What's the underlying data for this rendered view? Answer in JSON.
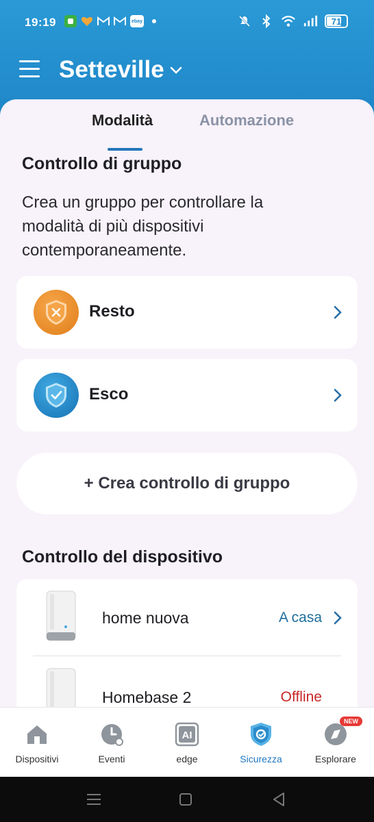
{
  "status_bar": {
    "time": "19:19",
    "battery": "71",
    "notification_icons": [
      "app-icon-green",
      "heart-icon",
      "gmail-icon",
      "gmail-icon",
      "ebay-icon",
      "dot-icon"
    ],
    "notification_colors": [
      "#3cb043",
      "#f3a73b"
    ],
    "ebay_label": "ebay",
    "system_icons": [
      "mute-icon",
      "bluetooth-icon",
      "wifi-icon",
      "signal-icon",
      "battery-icon"
    ]
  },
  "header": {
    "title": "Setteville",
    "menu_icon": "hamburger-icon",
    "dropdown_icon": "chevron-down-icon",
    "background": "#2a9ad6"
  },
  "tabs": [
    {
      "label": "Modalità",
      "active": true
    },
    {
      "label": "Automazione",
      "active": false
    }
  ],
  "group_control": {
    "title": "Controllo di gruppo",
    "description": "Crea un gruppo per controllare la modalità di più dispositivi contemporaneamente.",
    "items": [
      {
        "name": "Resto",
        "icon": "shield-x-icon",
        "color": "#ee8a24"
      },
      {
        "name": "Esco",
        "icon": "shield-check-icon",
        "color": "#1e8fd0"
      }
    ],
    "create_button": "+ Crea controllo di gruppo"
  },
  "device_control": {
    "title": "Controllo del dispositivo",
    "devices": [
      {
        "name": "home nuova",
        "status": "A casa",
        "status_color": "#1f6e9e"
      },
      {
        "name": "Homebase 2",
        "status": "Offline",
        "status_color": "#c62828"
      }
    ]
  },
  "bottom_nav": [
    {
      "label": "Dispositivi",
      "icon": "home-icon",
      "active": false
    },
    {
      "label": "Eventi",
      "icon": "clock-icon",
      "active": false
    },
    {
      "label": "edge",
      "icon": "ai-icon",
      "active": false
    },
    {
      "label": "Sicurezza",
      "icon": "security-shield-icon",
      "active": true
    },
    {
      "label": "Esplorare",
      "icon": "explore-icon",
      "active": false,
      "badge": "NEW"
    }
  ],
  "accent_color": "#1f77c0"
}
